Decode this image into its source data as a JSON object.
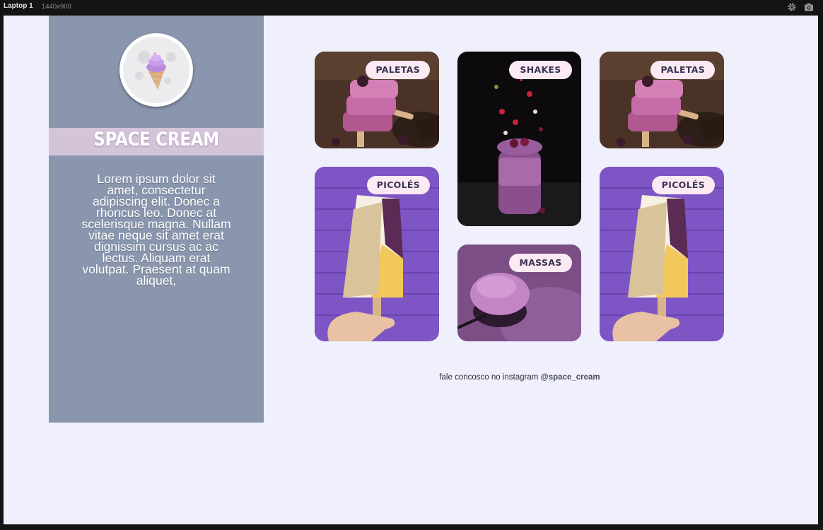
{
  "topbar": {
    "device": "Laptop 1",
    "size": "1440x900",
    "settings_icon": "gear-icon",
    "screenshot_icon": "camera-icon"
  },
  "sidebar": {
    "logo_icon": "ice-cream-moon-icon",
    "title": "SPACE CREAM",
    "description": "Lorem ipsum dolor sit amet, consectetur adipiscing elit. Donec a rhoncus leo. Donec at scelerisque magna. Nullam vitae neque sit amet erat dignissim cursus ac ac lectus. Aliquam erat volutpat. Praesent at quam aliquet,"
  },
  "cards": [
    {
      "label": "PALETAS",
      "image": "paletas-photo"
    },
    {
      "label": "SHAKES",
      "image": "shakes-photo"
    },
    {
      "label": "PALETAS",
      "image": "paletas-photo"
    },
    {
      "label": "PICOLÉS",
      "image": "picoles-photo"
    },
    {
      "label": "MASSAS",
      "image": "massas-photo"
    },
    {
      "label": "PICOLÉS",
      "image": "picoles-photo"
    }
  ],
  "footer": {
    "text": "fale concosco no instagram ",
    "handle": "@space_cream"
  },
  "colors": {
    "page_bg": "#f0f0fc",
    "sidebar_bg": "#8a96ae",
    "brand_bar": "#d4c4da",
    "pill_bg": "#fbe9f4",
    "pill_text": "#3a3450"
  }
}
